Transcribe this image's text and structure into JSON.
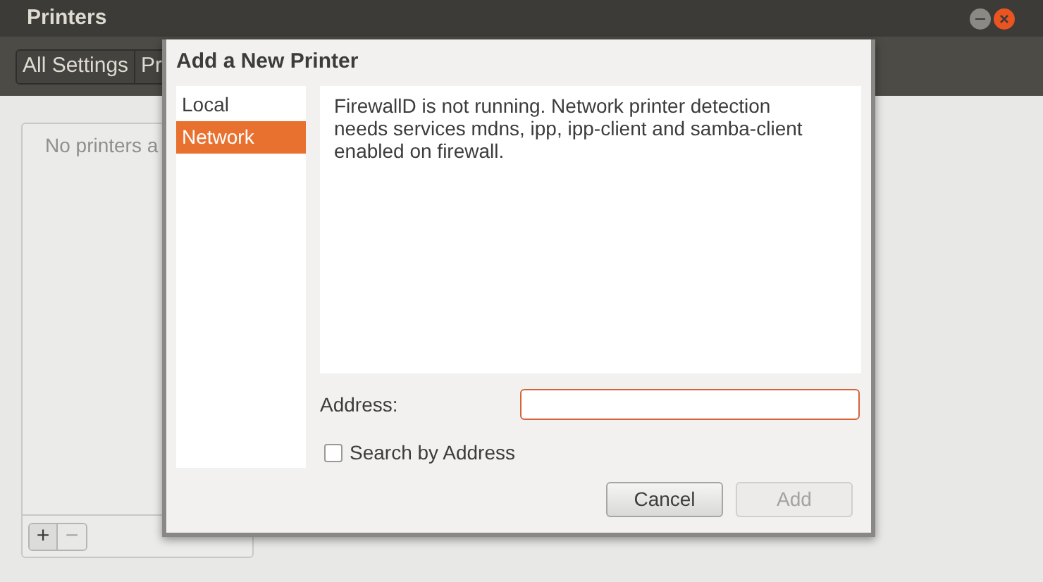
{
  "window": {
    "title": "Printers"
  },
  "toolbar": {
    "breadcrumbs": [
      "All Settings",
      "Pr"
    ]
  },
  "printer_list": {
    "empty_text": "No printers a"
  },
  "list_buttons": [
    "+",
    "−"
  ],
  "dialog": {
    "title": "Add a New Printer",
    "sources": [
      {
        "label": "Local",
        "selected": false
      },
      {
        "label": "Network",
        "selected": true
      }
    ],
    "message": "FirewallD is not running. Network printer detection needs services mdns, ipp, ipp-client and samba-client enabled on firewall.",
    "address": {
      "label": "Address:"
    },
    "search_by_address": {
      "label": "Search by Address",
      "checked": false
    },
    "buttons": [
      {
        "label": "Cancel",
        "disabled": false
      },
      {
        "label": "Add",
        "disabled": true
      }
    ]
  }
}
